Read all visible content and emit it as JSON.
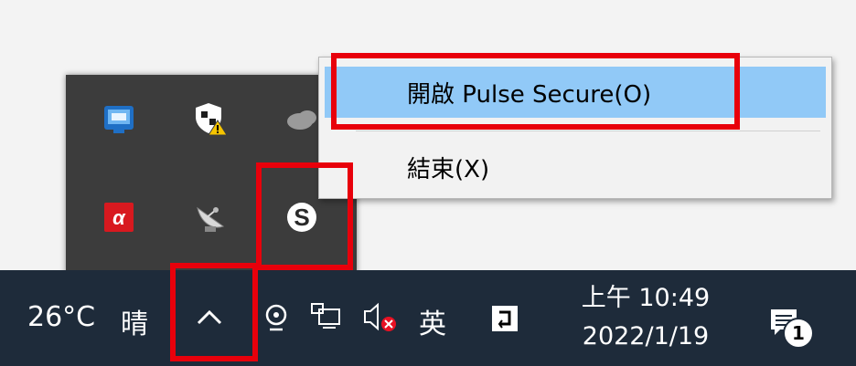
{
  "context_menu": {
    "open_label": "開啟 Pulse Secure(O)",
    "exit_label": "結束(X)"
  },
  "tray_flyout": {
    "icons": [
      "intel-graphics-icon",
      "security-shield-warning-icon",
      "onedrive-cloud-icon",
      "avira-antivirus-icon",
      "satellite-dish-icon",
      "pulse-secure-icon"
    ]
  },
  "taskbar": {
    "weather_temp": "26°C",
    "weather_cond": "晴",
    "input_method": "英",
    "time": "上午 10:49",
    "date": "2022/1/19",
    "notification_count": "1"
  },
  "colors": {
    "taskbar_bg": "#1e2b3a",
    "flyout_bg": "#3c3c3c",
    "menu_highlight": "#91c9f7",
    "annotation_red": "#e8000b"
  }
}
